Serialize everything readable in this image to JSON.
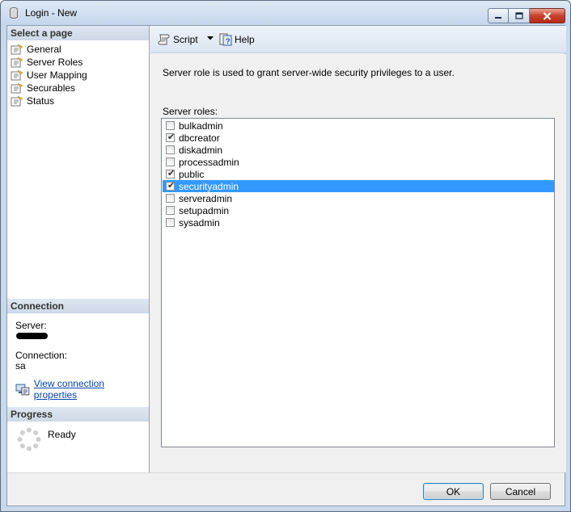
{
  "window": {
    "title": "Login - New"
  },
  "left": {
    "select_page_header": "Select a page",
    "pages": [
      {
        "label": "General"
      },
      {
        "label": "Server Roles"
      },
      {
        "label": "User Mapping"
      },
      {
        "label": "Securables"
      },
      {
        "label": "Status"
      }
    ],
    "connection_header": "Connection",
    "server_label": "Server:",
    "connection_label": "Connection:",
    "connection_value": "sa",
    "view_props_link": "View connection properties",
    "progress_header": "Progress",
    "progress_status": "Ready"
  },
  "toolbar": {
    "script_label": "Script",
    "help_label": "Help"
  },
  "main": {
    "description": "Server role is used to grant server-wide security privileges to a user.",
    "roles_label": "Server roles:",
    "roles": [
      {
        "name": "bulkadmin",
        "checked": false,
        "selected": false
      },
      {
        "name": "dbcreator",
        "checked": true,
        "selected": false
      },
      {
        "name": "diskadmin",
        "checked": false,
        "selected": false
      },
      {
        "name": "processadmin",
        "checked": false,
        "selected": false
      },
      {
        "name": "public",
        "checked": true,
        "selected": false
      },
      {
        "name": "securityadmin",
        "checked": true,
        "selected": true
      },
      {
        "name": "serveradmin",
        "checked": false,
        "selected": false
      },
      {
        "name": "setupadmin",
        "checked": false,
        "selected": false
      },
      {
        "name": "sysadmin",
        "checked": false,
        "selected": false
      }
    ]
  },
  "buttons": {
    "ok": "OK",
    "cancel": "Cancel"
  },
  "colors": {
    "selection": "#3399ff",
    "link": "#0645ad",
    "section_header": "#cdd9e7"
  }
}
